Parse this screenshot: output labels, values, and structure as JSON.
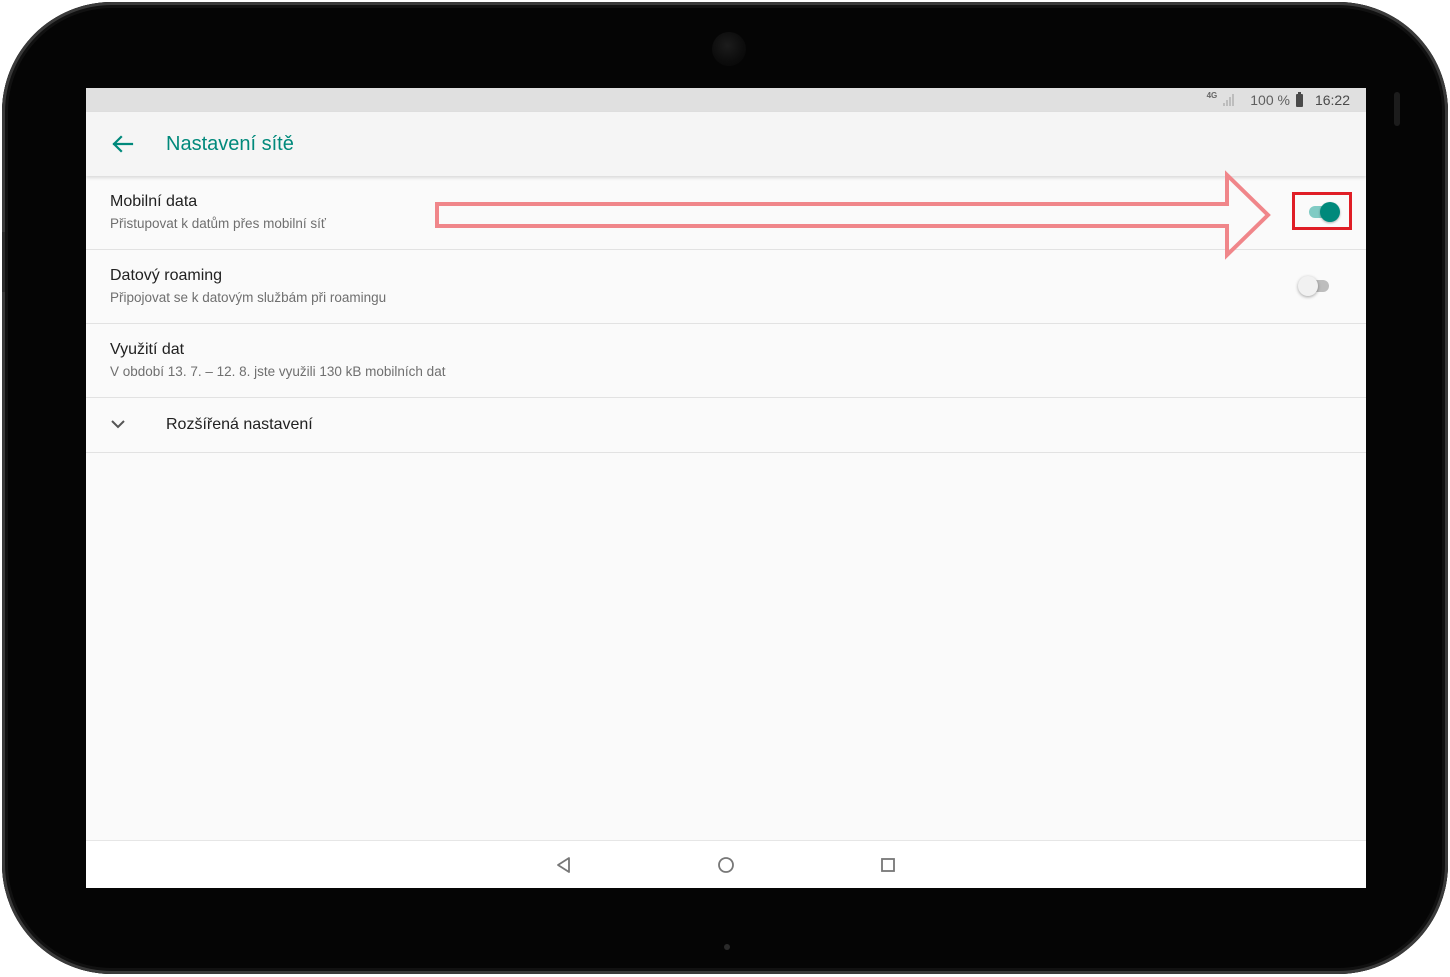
{
  "status_bar": {
    "network_type": "4G",
    "battery_text": "100 %",
    "time": "16:22"
  },
  "app_bar": {
    "back_icon": "arrow-left-icon",
    "title": "Nastavení sítě"
  },
  "settings": [
    {
      "title": "Mobilní data",
      "summary": "Přistupovat k datům přes mobilní síť",
      "toggle": true
    },
    {
      "title": "Datový roaming",
      "summary": "Připojovat se k datovým službám při roamingu",
      "toggle": false
    },
    {
      "title": "Využití dat",
      "summary": "V období 13. 7. – 12. 8. jste využili 130 kB mobilních dat"
    }
  ],
  "advanced": {
    "icon": "chevron-down-icon",
    "label": "Rozšířená nastavení"
  },
  "nav_bar": {
    "back": "nav-back-icon",
    "home": "nav-home-icon",
    "recents": "nav-recents-icon"
  },
  "colors": {
    "accent": "#00897b",
    "toggle_track_on": "#80cbc4",
    "annotation_arrow": "#f0868a",
    "annotation_box": "#e01e26"
  }
}
